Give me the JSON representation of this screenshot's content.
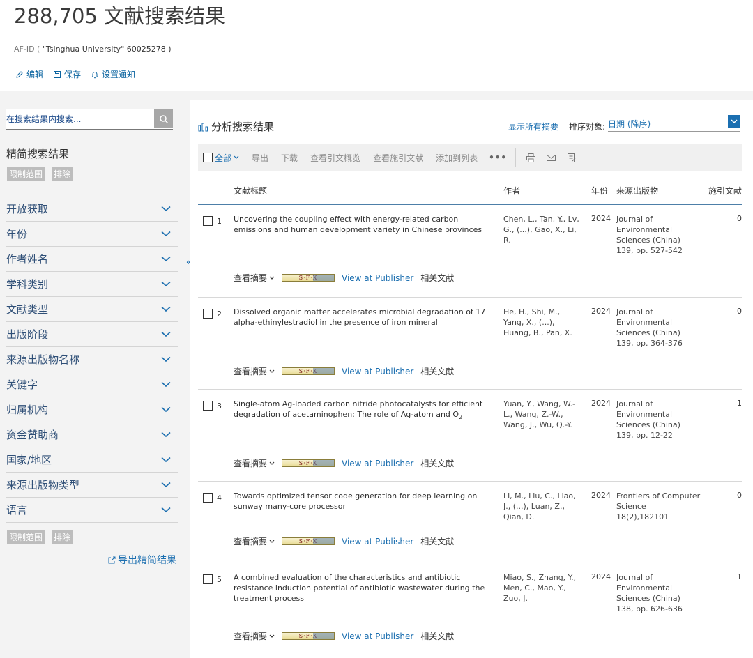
{
  "header": {
    "results_title": "288,705 文献搜索结果",
    "query_prefix": "AF-ID (",
    "query_org": "\"Tsinghua University\"",
    "query_id": "60025278 )",
    "actions": {
      "edit": "编辑",
      "save": "保存",
      "notify": "设置通知"
    }
  },
  "sidebar": {
    "search_placeholder": "在搜索结果内搜索...",
    "refine_title": "精简搜索结果",
    "limit_label": "限制范围",
    "exclude_label": "排除",
    "facets": [
      "开放获取",
      "年份",
      "作者姓名",
      "学科类别",
      "文献类型",
      "出版阶段",
      "来源出版物名称",
      "关键字",
      "归属机构",
      "资金赞助商",
      "国家/地区",
      "来源出版物类型",
      "语言"
    ],
    "export_refine": "导出精简结果",
    "collapse": "«"
  },
  "main": {
    "analyze": "分析搜索结果",
    "show_abstracts": "显示所有摘要",
    "sort_label": "排序对象:",
    "sort_value": "日期 (降序)",
    "toolbar": {
      "all": "全部",
      "export": "导出",
      "download": "下载",
      "citation_overview": "查看引文概览",
      "cited_by": "查看施引文献",
      "add_to_list": "添加到列表",
      "more": "•••"
    },
    "columns": {
      "title": "文献标题",
      "authors": "作者",
      "year": "年份",
      "source": "来源出版物",
      "cited": "施引文献"
    },
    "link_labels": {
      "abstract": "查看摘要",
      "sfx": "S·F·X",
      "publisher": "View at Publisher",
      "related": "相关文献"
    },
    "results": [
      {
        "num": "1",
        "title": "Uncovering the coupling effect with energy-related carbon emissions and human development variety in Chinese provinces",
        "authors": "Chen, L., Tan, Y., Lv, G., (...), Gao, X., Li, R.",
        "year": "2024",
        "source": "Journal of Environmental Sciences (China)",
        "source_detail": "139, pp. 527-542",
        "cited": "0"
      },
      {
        "num": "2",
        "title": "Dissolved organic matter accelerates microbial degradation of 17 alpha-ethinylestradiol in the presence of iron mineral",
        "authors": "He, H., Shi, M., Yang, X., (...), Huang, B., Pan, X.",
        "year": "2024",
        "source": "Journal of Environmental Sciences (China)",
        "source_detail": "139, pp. 364-376",
        "cited": "0"
      },
      {
        "num": "3",
        "title": "Single-atom Ag-loaded carbon nitride photocatalysts for efficient degradation of acetaminophen: The role of Ag-atom and O",
        "title_sub": "2",
        "authors": "Yuan, Y., Wang, W.-L., Wang, Z.-W., Wang, J., Wu, Q.-Y.",
        "year": "2024",
        "source": "Journal of Environmental Sciences (China)",
        "source_detail": "139, pp. 12-22",
        "cited": "1"
      },
      {
        "num": "4",
        "title": "Towards optimized tensor code generation for deep learning on sunway many-core processor",
        "authors": "Li, M., Liu, C., Liao, J., (...), Luan, Z., Qian, D.",
        "year": "2024",
        "source": "Frontiers of Computer Science",
        "source_detail": "18(2),182101",
        "cited": "0"
      },
      {
        "num": "5",
        "title": "A combined evaluation of the characteristics and antibiotic resistance induction potential of antibiotic wastewater during the treatment process",
        "authors": "Miao, S., Zhang, Y., Men, C., Mao, Y., Zuo, J.",
        "year": "2024",
        "source": "Journal of Environmental Sciences (China)",
        "source_detail": "138, pp. 626-636",
        "cited": "1"
      }
    ]
  },
  "colors": {
    "link": "#1c6fb0",
    "facet_text": "#2f4f77",
    "tag_bg": "#bdbdbd",
    "sort_dropdown": "#1b6fb1"
  }
}
